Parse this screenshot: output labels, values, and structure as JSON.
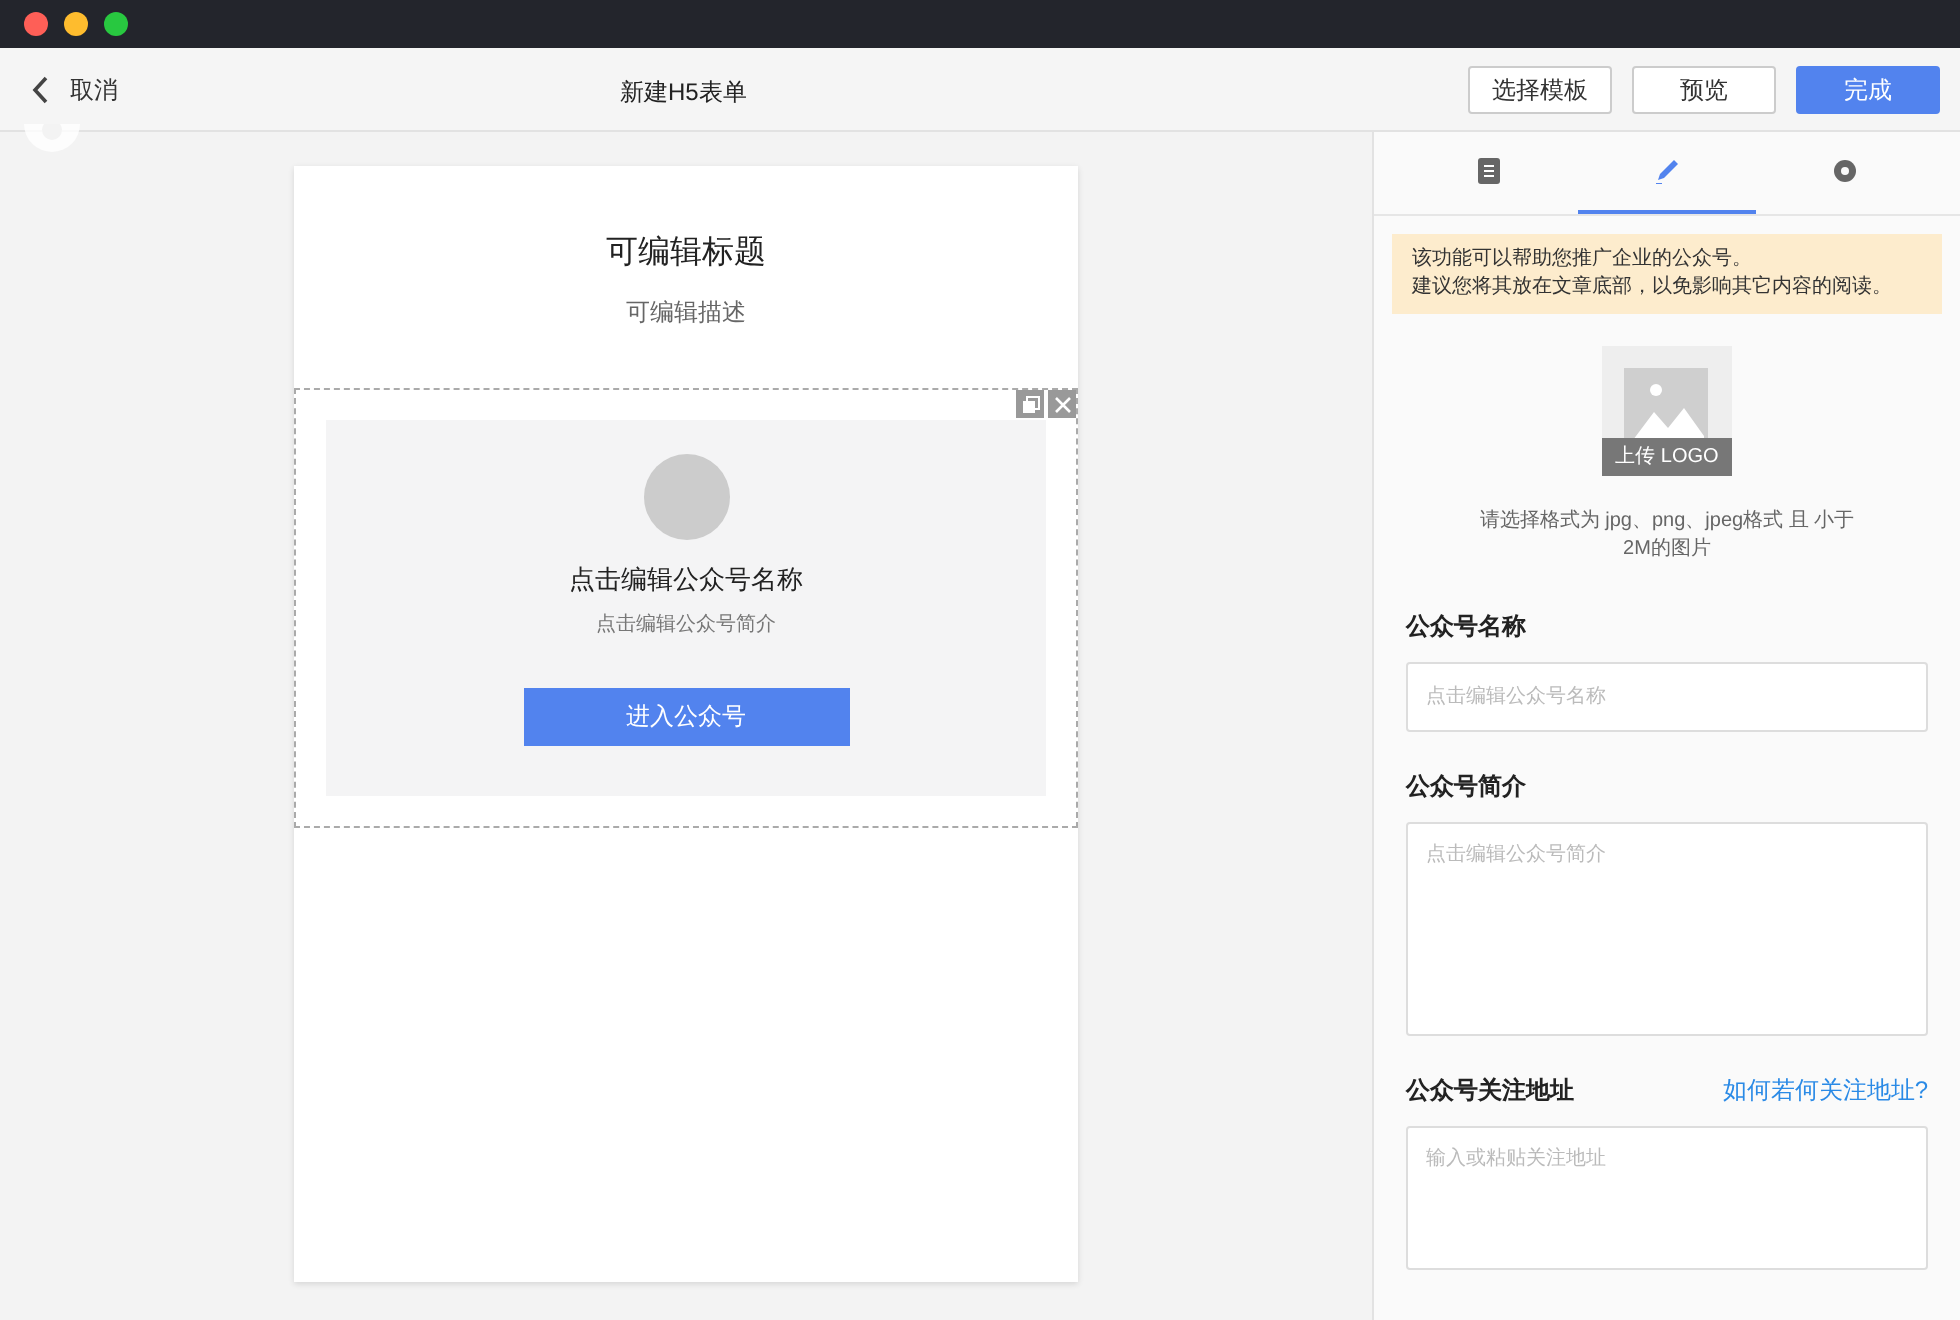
{
  "header": {
    "back_label": "取消",
    "title": "新建H5表单",
    "buttons": [
      {
        "label": "选择模板",
        "kind": "default"
      },
      {
        "label": "预览",
        "kind": "default"
      },
      {
        "label": "完成",
        "kind": "primary"
      }
    ]
  },
  "canvas": {
    "form_title": "可编辑标题",
    "form_description": "可编辑描述",
    "card": {
      "name": "点击编辑公众号名称",
      "intro": "点击编辑公众号简介",
      "button": "进入公众号"
    }
  },
  "panel": {
    "tabs": [
      {
        "kind": "document",
        "selected": false
      },
      {
        "kind": "edit",
        "selected": true
      },
      {
        "kind": "settings",
        "selected": false
      }
    ],
    "notice": [
      "该功能可以帮助您推广企业的公众号。",
      "建议您将其放在文章底部，以免影响其它内容的阅读。"
    ],
    "upload_label": "上传 LOGO",
    "upload_hint": "请选择格式为 jpg、png、jpeg格式 且 小于 2M的图片",
    "fields": [
      {
        "label": "公众号名称",
        "placeholder": "点击编辑公众号名称",
        "kind": "input"
      },
      {
        "label": "公众号简介",
        "placeholder": "点击编辑公众号简介",
        "kind": "textarea"
      },
      {
        "label": "公众号关注地址",
        "placeholder": "输入或粘贴关注地址",
        "kind": "textarea_short",
        "link": "如何若何关注地址?"
      }
    ]
  }
}
